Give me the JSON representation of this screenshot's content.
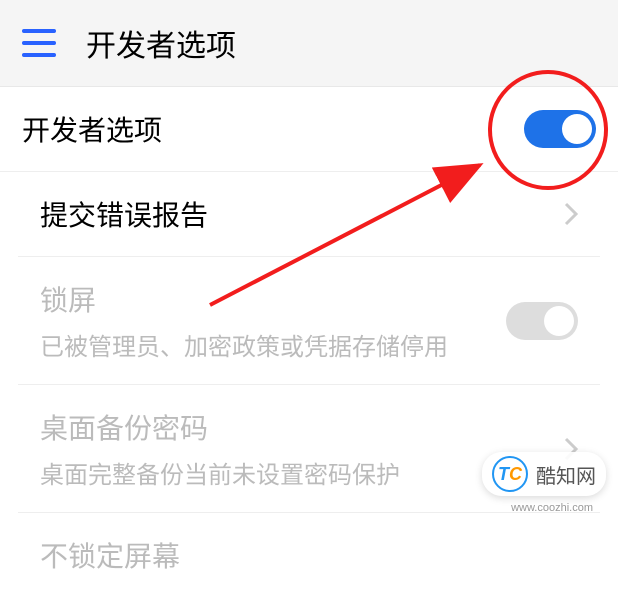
{
  "header": {
    "title": "开发者选项"
  },
  "settings": {
    "devOptions": {
      "title": "开发者选项"
    },
    "bugReport": {
      "title": "提交错误报告"
    },
    "lockScreen": {
      "title": "锁屏",
      "subtitle": "已被管理员、加密政策或凭据存储停用"
    },
    "backupPassword": {
      "title": "桌面备份密码",
      "subtitle": "桌面完整备份当前未设置密码保护"
    },
    "stayAwake": {
      "title": "不锁定屏幕"
    }
  },
  "watermark": {
    "name": "酷知网",
    "url": "www.coozhi.com",
    "logoT": "T",
    "logoC": "C"
  }
}
